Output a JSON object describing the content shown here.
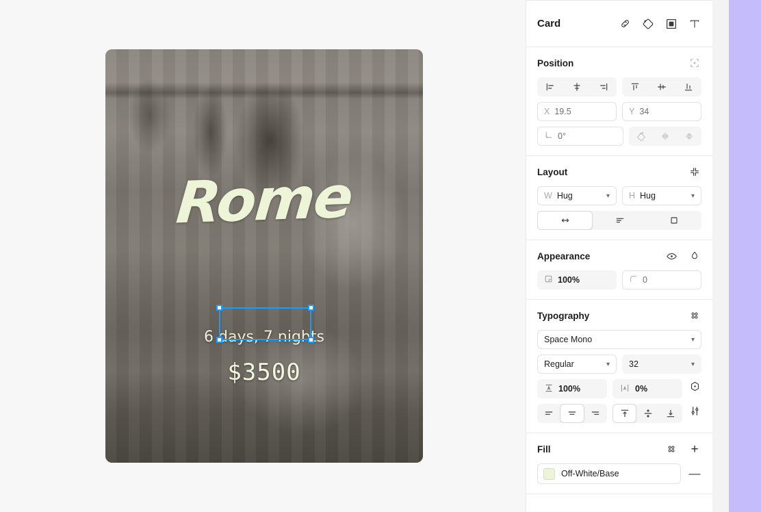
{
  "canvas": {
    "background_color": "#f7f7f7",
    "card": {
      "title": "Rome",
      "subtitle": "6 days, 7 nights",
      "price": "$3500",
      "title_color": "#eef4d8",
      "selection_color": "#1b9aff"
    }
  },
  "panel": {
    "node": {
      "title": "Card",
      "actions": [
        {
          "name": "link-icon",
          "label": "Link"
        },
        {
          "name": "component-icon",
          "label": "Component"
        },
        {
          "name": "frame-icon",
          "label": "Frame"
        },
        {
          "name": "text-icon",
          "label": "Text"
        }
      ]
    },
    "position": {
      "title": "Position",
      "absolute_icon": "absolute-position-icon",
      "align": [
        {
          "name": "align-left-icon",
          "label": "Align left"
        },
        {
          "name": "align-horizontal-center-icon",
          "label": "Align horizontal center"
        },
        {
          "name": "align-right-icon",
          "label": "Align right"
        }
      ],
      "align_v": [
        {
          "name": "align-top-icon",
          "label": "Align top"
        },
        {
          "name": "align-vertical-center-icon",
          "label": "Align vertical center"
        },
        {
          "name": "align-bottom-icon",
          "label": "Align bottom"
        }
      ],
      "x_label": "X",
      "x_value": "19.5",
      "y_label": "Y",
      "y_value": "34",
      "rotation_value": "0°",
      "transform": [
        {
          "name": "rotate-icon",
          "label": "Rotate"
        },
        {
          "name": "flip-horizontal-icon",
          "label": "Flip horizontal"
        },
        {
          "name": "flip-vertical-icon",
          "label": "Flip vertical"
        }
      ]
    },
    "layout": {
      "title": "Layout",
      "collapse_icon": "collapse-icon",
      "width_label": "W",
      "width_value": "Hug",
      "height_label": "H",
      "height_value": "Hug",
      "modes": [
        {
          "name": "resize-horizontal-icon",
          "label": "Horizontal resizing",
          "selected": true
        },
        {
          "name": "text-wrap-icon",
          "label": "Text wrap",
          "selected": false
        },
        {
          "name": "clip-content-icon",
          "label": "Clip content",
          "selected": false
        }
      ]
    },
    "appearance": {
      "title": "Appearance",
      "visibility_icon": "eye-icon",
      "blend_icon": "blend-mode-icon",
      "opacity_value": "100%",
      "opacity_icon": "opacity-icon",
      "corner_value": "0",
      "corner_icon": "corner-radius-icon"
    },
    "typography": {
      "title": "Typography",
      "styles_icon": "text-styles-icon",
      "font_family": "Space Mono",
      "font_weight": "Regular",
      "font_size": "32",
      "line_height_value": "100%",
      "line_height_icon": "line-height-icon",
      "letter_spacing_value": "0%",
      "letter_spacing_icon": "letter-spacing-icon",
      "variable_icon": "font-variable-icon",
      "settings_icon": "type-settings-icon",
      "align_h": [
        {
          "name": "text-align-left-icon",
          "label": "Align left",
          "selected": false
        },
        {
          "name": "text-align-center-icon",
          "label": "Align center",
          "selected": true
        },
        {
          "name": "text-align-right-icon",
          "label": "Align right",
          "selected": false
        }
      ],
      "align_v": [
        {
          "name": "text-align-top-icon",
          "label": "Align top",
          "selected": true
        },
        {
          "name": "text-align-middle-icon",
          "label": "Align middle",
          "selected": false
        },
        {
          "name": "text-align-bottom-icon",
          "label": "Align bottom",
          "selected": false
        }
      ]
    },
    "fill": {
      "title": "Fill",
      "styles_icon": "fill-styles-icon",
      "add_label": "+",
      "remove_label": "—",
      "items": [
        {
          "name": "Off-White/Base",
          "color": "#eef4d8"
        }
      ]
    }
  },
  "right_strip": {
    "color": "#c5bcfc"
  }
}
